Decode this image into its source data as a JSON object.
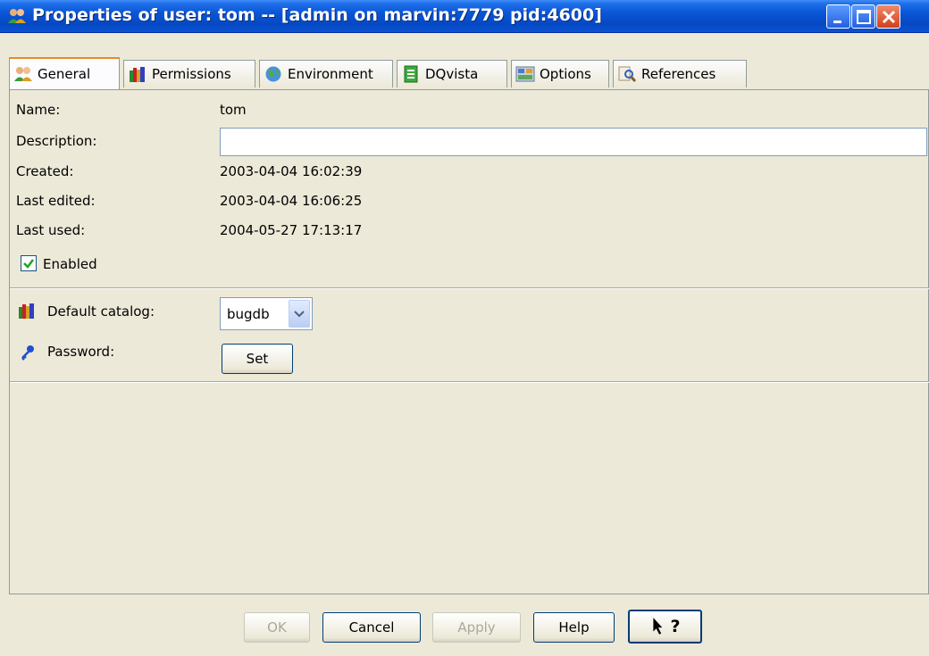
{
  "window": {
    "title": "Properties of user: tom -- [admin on marvin:7779 pid:4600]",
    "icon": "users-icon"
  },
  "tabs": [
    {
      "label": "General",
      "icon": "users-icon",
      "active": true
    },
    {
      "label": "Permissions",
      "icon": "books-icon",
      "active": false
    },
    {
      "label": "Environment",
      "icon": "globe-icon",
      "active": false
    },
    {
      "label": "DQvista",
      "icon": "document-icon",
      "active": false
    },
    {
      "label": "Options",
      "icon": "options-icon",
      "active": false
    },
    {
      "label": "References",
      "icon": "magnifier-icon",
      "active": false
    }
  ],
  "general": {
    "name_label": "Name:",
    "name_value": "tom",
    "description_label": "Description:",
    "description_value": "",
    "created_label": "Created:",
    "created_value": "2003-04-04 16:02:39",
    "last_edited_label": "Last edited:",
    "last_edited_value": "2003-04-04 16:06:25",
    "last_used_label": "Last used:",
    "last_used_value": "2004-05-27 17:13:17",
    "enabled_label": "Enabled",
    "enabled_checked": true,
    "default_catalog_label": "Default catalog:",
    "default_catalog_value": "bugdb",
    "password_label": "Password:",
    "set_button": "Set"
  },
  "buttons": {
    "ok": "OK",
    "cancel": "Cancel",
    "apply": "Apply",
    "help": "Help",
    "whats_this": "?"
  },
  "colors": {
    "titlebar": "#0548c4",
    "face": "#ece9d8",
    "active_tab_accent": "#e68b2c"
  }
}
